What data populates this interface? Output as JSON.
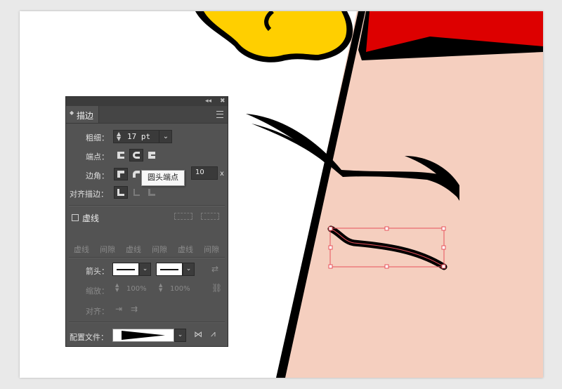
{
  "panel": {
    "tab_label": "描边",
    "collapse_glyph": "◂◂",
    "close_glyph": "✖",
    "weight": {
      "label": "粗细：",
      "value": "17 pt"
    },
    "cap": {
      "label": "端点："
    },
    "corner": {
      "label": "边角：",
      "limit_value": "10",
      "limit_suffix": "x"
    },
    "align": {
      "label": "对齐描边："
    },
    "dashed": {
      "label": "虚线",
      "checked": false
    },
    "dash_fields": [
      "虚线",
      "间隙",
      "虚线",
      "间隙",
      "虚线",
      "间隙"
    ],
    "arrow": {
      "label": "箭头："
    },
    "scale": {
      "label": "缩放：",
      "start": "100%",
      "end": "100%"
    },
    "alignment": {
      "label": "对齐："
    },
    "profile": {
      "label": "配置文件："
    }
  },
  "tooltip": {
    "text": "圆头端点"
  },
  "colors": {
    "skin": "#f5cfbf",
    "red": "#dd0000",
    "yellow": "#ffcf00",
    "panel": "#535353",
    "selection": "#e8505b"
  }
}
